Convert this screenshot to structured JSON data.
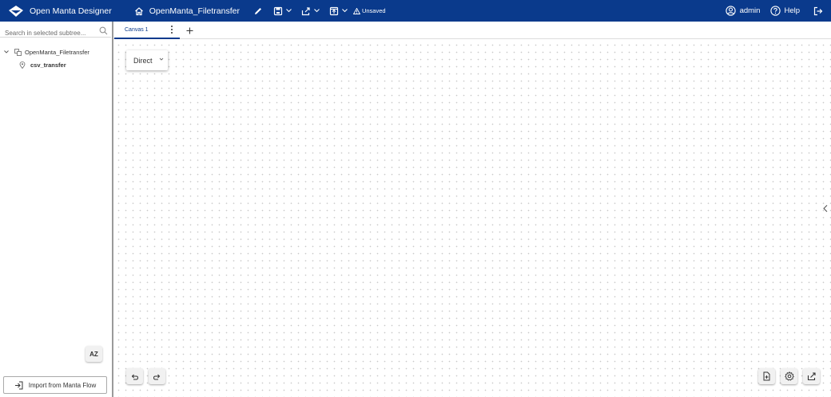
{
  "header": {
    "app_title": "Open Manta Designer",
    "project_name": "OpenManta_Filetransfer",
    "status_text": "Unsaved",
    "user_name": "admin",
    "help_label": "Help",
    "bg_color": "#0a3a8c"
  },
  "sidebar": {
    "search_placeholder": "Search in selected subtree...",
    "tree": {
      "root_label": "OpenManta_Filetransfer",
      "child_label": "csv_transfer"
    },
    "sort_label": "AZ",
    "import_label": "Import from Manta Flow"
  },
  "tabs": [
    {
      "label": "Canvas 1",
      "active": true
    }
  ],
  "canvas": {
    "node_label": "Direct"
  },
  "icons": {
    "logo": "diamond-logo-icon",
    "home": "home-icon",
    "edit": "pencil-icon",
    "save": "save-icon",
    "export": "export-icon",
    "publish": "publish-icon",
    "warning": "warning-icon",
    "user": "user-icon",
    "help": "help-icon",
    "logout": "logout-icon",
    "undo": "undo-icon",
    "redo": "redo-icon",
    "new_file": "new-file-icon",
    "settings": "gear-icon",
    "share": "share-icon"
  }
}
